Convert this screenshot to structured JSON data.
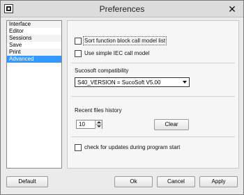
{
  "window": {
    "title": "Preferences",
    "close_glyph": "✕"
  },
  "nav": {
    "items": [
      {
        "label": "Interface"
      },
      {
        "label": "Editor"
      },
      {
        "label": "Sessions"
      },
      {
        "label": "Save"
      },
      {
        "label": "Print"
      },
      {
        "label": "Advanced",
        "selected": true
      }
    ]
  },
  "advanced": {
    "sort_function_block_label": "Sort function block call model list",
    "sort_function_block_checked": false,
    "simple_iec_label": "Use simple IEC call model",
    "simple_iec_checked": false,
    "compat_heading": "Sucosoft compatibility",
    "compat_value": "S40_VERSION = SucoSoft V5.00",
    "recent_heading": "Recent files history",
    "recent_value": "10",
    "clear_label": "Clear",
    "updates_label": "check for updates during program start",
    "updates_checked": false
  },
  "footer": {
    "default_label": "Default",
    "ok_label": "Ok",
    "cancel_label": "Cancel",
    "apply_label": "Apply"
  },
  "colors": {
    "selection": "#3399ff",
    "window_bg": "#ebebeb"
  }
}
